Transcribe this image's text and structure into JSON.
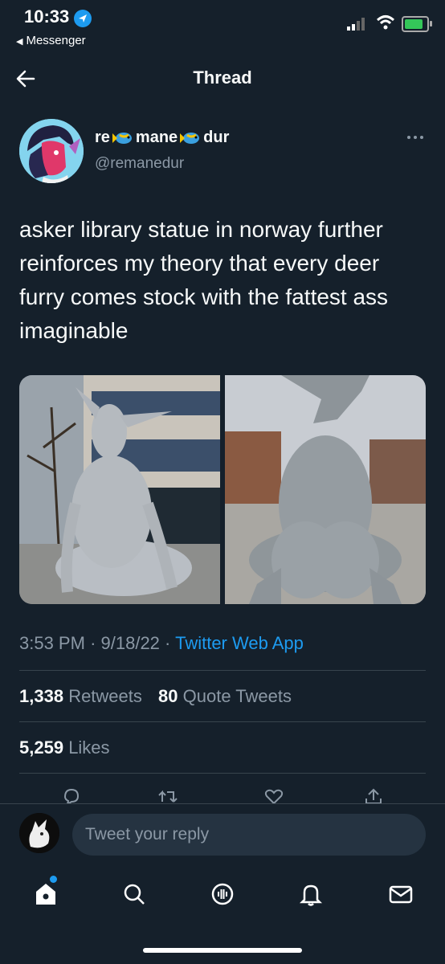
{
  "status_bar": {
    "time": "10:33",
    "back_app": "Messenger"
  },
  "header": {
    "title": "Thread"
  },
  "author": {
    "name_parts": [
      "re",
      "mane",
      "dur"
    ],
    "handle": "@remanedur"
  },
  "tweet": {
    "text": "asker library statue in norway further reinforces my theory that every deer furry comes stock with the fattest ass imaginable",
    "time": "3:53 PM",
    "date": "9/18/22",
    "source": "Twitter Web App",
    "sep": "·"
  },
  "stats": {
    "retweets_count": "1,338",
    "retweets_label": "Retweets",
    "quotes_count": "80",
    "quotes_label": "Quote Tweets",
    "likes_count": "5,259",
    "likes_label": "Likes"
  },
  "reply": {
    "placeholder": "Tweet your reply"
  },
  "colors": {
    "background": "#15202b",
    "accent": "#1d9bf0",
    "muted": "#8b98a5"
  },
  "icons": [
    "back-arrow-icon",
    "more-icon",
    "reply-icon",
    "retweet-icon",
    "like-icon",
    "share-icon",
    "home-icon",
    "search-icon",
    "spaces-icon",
    "notifications-icon",
    "messages-icon"
  ]
}
